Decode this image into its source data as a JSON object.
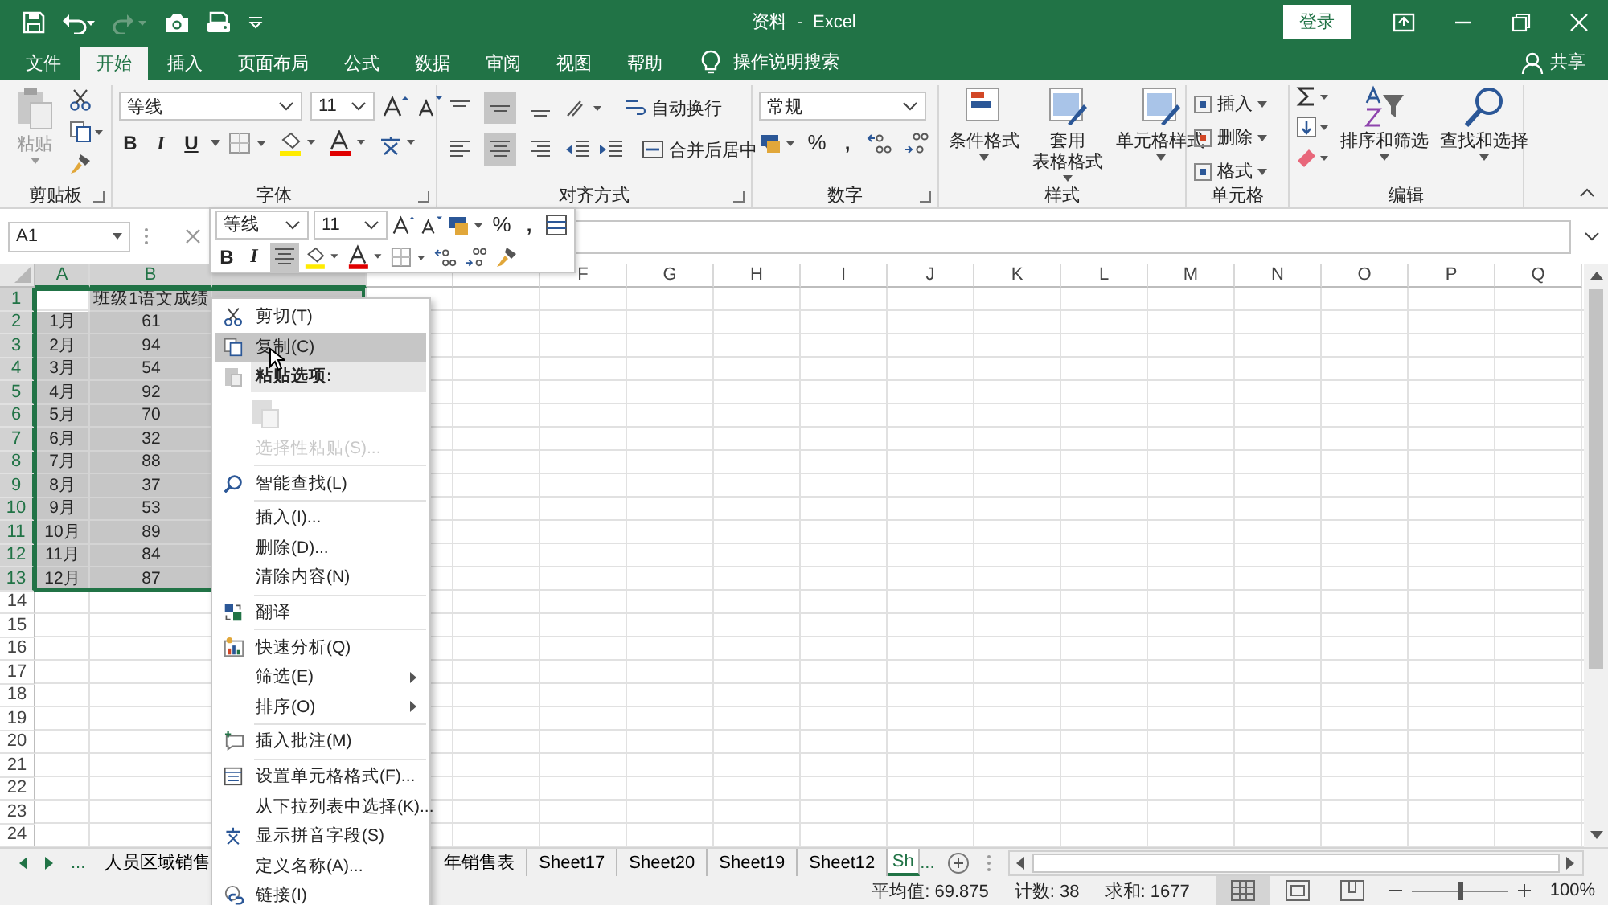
{
  "title_bar": {
    "title": "资料  -  Excel",
    "sign_in": "登录"
  },
  "menu_tabs": [
    {
      "label": "文件",
      "selected": false
    },
    {
      "label": "开始",
      "selected": true
    },
    {
      "label": "插入",
      "selected": false
    },
    {
      "label": "页面布局",
      "selected": false
    },
    {
      "label": "公式",
      "selected": false
    },
    {
      "label": "数据",
      "selected": false
    },
    {
      "label": "审阅",
      "selected": false
    },
    {
      "label": "视图",
      "selected": false
    },
    {
      "label": "帮助",
      "selected": false
    }
  ],
  "tell_me": "操作说明搜索",
  "share": "共享",
  "ribbon": {
    "clipboard": {
      "paste": "粘贴",
      "label": "剪贴板"
    },
    "font": {
      "name": "等线",
      "size": "11",
      "styles": [
        "B",
        "I",
        "U"
      ],
      "label": "字体"
    },
    "alignment": {
      "vertical": [
        {
          "selected": false
        },
        {
          "selected": true
        },
        {
          "selected": false
        }
      ],
      "horizontal": [
        {
          "selected": false
        },
        {
          "selected": true
        },
        {
          "selected": false
        }
      ],
      "wrap_text": "自动换行",
      "merge": "合并后居中",
      "label": "对齐方式"
    },
    "number": {
      "format": "常规",
      "symbols": [
        "%",
        ","
      ],
      "label": "数字"
    },
    "styles": {
      "buttons": [
        {
          "lines": [
            "条件格式"
          ]
        },
        {
          "lines": [
            "套用",
            "表格格式"
          ]
        },
        {
          "lines": [
            "单元格样式"
          ]
        }
      ],
      "label": "样式"
    },
    "cells": {
      "buttons": [
        "插入",
        "删除",
        "格式"
      ],
      "label": "单元格"
    },
    "editing": {
      "buttons": [
        "排序和筛选",
        "查找和选择"
      ],
      "label": "编辑"
    }
  },
  "name_box": "A1",
  "mini_toolbar": {
    "font": "等线",
    "size": "11",
    "symbols": [
      "%",
      ","
    ],
    "styles": [
      "B",
      "I"
    ],
    "align": [
      {
        "selected": true
      }
    ]
  },
  "columns": [
    {
      "label": "A",
      "selected": true
    },
    {
      "label": "B",
      "selected": true
    },
    {
      "selected": true
    },
    {
      "selected": false
    },
    {
      "selected": false
    },
    {
      "label": "F",
      "selected": false
    },
    {
      "label": "G",
      "selected": false
    },
    {
      "label": "H",
      "selected": false
    },
    {
      "label": "I",
      "selected": false
    },
    {
      "label": "J",
      "selected": false
    },
    {
      "label": "K",
      "selected": false
    },
    {
      "label": "L",
      "selected": false
    },
    {
      "label": "M",
      "selected": false
    },
    {
      "label": "N",
      "selected": false
    },
    {
      "label": "O",
      "selected": false
    },
    {
      "label": "P",
      "selected": false
    },
    {
      "label": "Q",
      "selected": false
    }
  ],
  "rows": [
    {
      "label": "1",
      "selected": true,
      "cells": [
        {
          "selected": false
        },
        {
          "text": "班级1语文成绩",
          "selected": true
        },
        {
          "selected": true
        }
      ]
    },
    {
      "label": "2",
      "selected": true,
      "cells": [
        {
          "text": "1月",
          "selected": true
        },
        {
          "text": "61",
          "selected": true
        }
      ]
    },
    {
      "label": "3",
      "selected": true,
      "cells": [
        {
          "text": "2月",
          "selected": true
        },
        {
          "text": "94",
          "selected": true
        }
      ]
    },
    {
      "label": "4",
      "selected": true,
      "cells": [
        {
          "text": "3月",
          "selected": true
        },
        {
          "text": "54",
          "selected": true
        }
      ]
    },
    {
      "label": "5",
      "selected": true,
      "cells": [
        {
          "text": "4月",
          "selected": true
        },
        {
          "text": "92",
          "selected": true
        }
      ]
    },
    {
      "label": "6",
      "selected": true,
      "cells": [
        {
          "text": "5月",
          "selected": true
        },
        {
          "text": "70",
          "selected": true
        }
      ]
    },
    {
      "label": "7",
      "selected": true,
      "cells": [
        {
          "text": "6月",
          "selected": true
        },
        {
          "text": "32",
          "selected": true
        }
      ]
    },
    {
      "label": "8",
      "selected": true,
      "cells": [
        {
          "text": "7月",
          "selected": true
        },
        {
          "text": "88",
          "selected": true
        }
      ]
    },
    {
      "label": "9",
      "selected": true,
      "cells": [
        {
          "text": "8月",
          "selected": true
        },
        {
          "text": "37",
          "selected": true
        }
      ]
    },
    {
      "label": "10",
      "selected": true,
      "cells": [
        {
          "text": "9月",
          "selected": true
        },
        {
          "text": "53",
          "selected": true
        }
      ]
    },
    {
      "label": "11",
      "selected": true,
      "cells": [
        {
          "text": "10月",
          "selected": true
        },
        {
          "text": "89",
          "selected": true
        }
      ]
    },
    {
      "label": "12",
      "selected": true,
      "cells": [
        {
          "text": "11月",
          "selected": true
        },
        {
          "text": "84",
          "selected": true
        }
      ]
    },
    {
      "label": "13",
      "selected": true,
      "cells": [
        {
          "text": "12月",
          "selected": true
        },
        {
          "text": "87",
          "selected": true
        }
      ]
    },
    {
      "label": "14",
      "selected": false
    },
    {
      "label": "15",
      "selected": false
    },
    {
      "label": "16",
      "selected": false
    },
    {
      "label": "17",
      "selected": false
    },
    {
      "label": "18",
      "selected": false
    },
    {
      "label": "19",
      "selected": false
    },
    {
      "label": "20",
      "selected": false
    },
    {
      "label": "21",
      "selected": false
    },
    {
      "label": "22",
      "selected": false
    },
    {
      "label": "23",
      "selected": false
    },
    {
      "label": "24",
      "selected": false
    }
  ],
  "context_menu": {
    "groups": [
      [
        {
          "kind": "item",
          "label": "剪切(T)",
          "selected": false,
          "disabled": false,
          "submenu": false
        },
        {
          "kind": "item",
          "label": "复制(C)",
          "selected": true,
          "disabled": false,
          "submenu": false
        },
        {
          "kind": "heading",
          "label": "粘贴选项:"
        },
        {
          "kind": "paste_options",
          "disabled": true
        },
        {
          "kind": "item",
          "label": "选择性粘贴(S)...",
          "selected": false,
          "disabled": true,
          "submenu": false
        }
      ],
      [
        {
          "kind": "item",
          "label": "智能查找(L)",
          "selected": false,
          "disabled": false,
          "submenu": false
        }
      ],
      [
        {
          "kind": "item",
          "label": "插入(I)...",
          "selected": false,
          "disabled": false,
          "submenu": false
        },
        {
          "kind": "item",
          "label": "删除(D)...",
          "selected": false,
          "disabled": false,
          "submenu": false
        },
        {
          "kind": "item",
          "label": "清除内容(N)",
          "selected": false,
          "disabled": false,
          "submenu": false
        }
      ],
      [
        {
          "kind": "item",
          "label": "翻译",
          "selected": false,
          "disabled": false,
          "submenu": false
        }
      ],
      [
        {
          "kind": "item",
          "label": "快速分析(Q)",
          "selected": false,
          "disabled": false,
          "submenu": false
        },
        {
          "kind": "item",
          "label": "筛选(E)",
          "selected": false,
          "disabled": false,
          "submenu": true
        },
        {
          "kind": "item",
          "label": "排序(O)",
          "selected": false,
          "disabled": false,
          "submenu": true
        }
      ],
      [
        {
          "kind": "item",
          "label": "插入批注(M)",
          "selected": false,
          "disabled": false,
          "submenu": false
        }
      ],
      [
        {
          "kind": "item",
          "label": "设置单元格格式(F)...",
          "selected": false,
          "disabled": false,
          "submenu": false
        },
        {
          "kind": "item",
          "label": "从下拉列表中选择(K)...",
          "selected": false,
          "disabled": false,
          "submenu": false
        },
        {
          "kind": "item",
          "label": "显示拼音字段(S)",
          "selected": false,
          "disabled": false,
          "submenu": false
        },
        {
          "kind": "item",
          "label": "定义名称(A)...",
          "selected": false,
          "disabled": false,
          "submenu": false
        },
        {
          "kind": "item",
          "label": "链接(I)",
          "selected": false,
          "disabled": false,
          "submenu": false
        }
      ]
    ]
  },
  "sheet_nav": {
    "more_left": "...",
    "more_right": "..."
  },
  "sheet_tabs": [
    {
      "label": "人员区域销售",
      "selected": false
    },
    {
      "label": "年销售表",
      "selected": false
    },
    {
      "label": "Sheet17",
      "selected": false
    },
    {
      "label": "Sheet20",
      "selected": false
    },
    {
      "label": "Sheet19",
      "selected": false
    },
    {
      "label": "Sheet12",
      "selected": false
    },
    {
      "label": "Sh",
      "selected": true
    }
  ],
  "status_bar": {
    "stats": [
      "平均值: 69.875",
      "计数: 38",
      "求和: 1677"
    ],
    "views": [
      {
        "selected": true
      },
      {
        "selected": false
      },
      {
        "selected": false
      }
    ],
    "zoom": {
      "level": 0.5,
      "reading": "100%"
    }
  }
}
